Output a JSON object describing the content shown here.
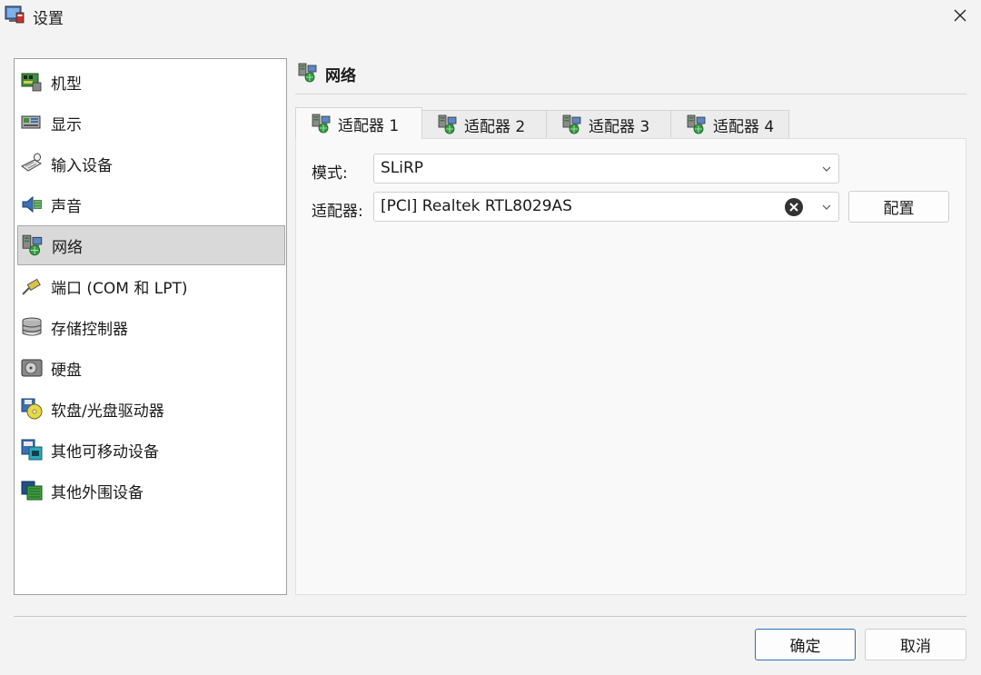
{
  "window": {
    "title": "设置",
    "app_icon": "settings-app-icon",
    "close_icon": "close-icon"
  },
  "sidebar": {
    "items": [
      {
        "label": "机型",
        "icon": "machine-icon",
        "selected": false
      },
      {
        "label": "显示",
        "icon": "display-icon",
        "selected": false
      },
      {
        "label": "输入设备",
        "icon": "input-device-icon",
        "selected": false
      },
      {
        "label": "声音",
        "icon": "sound-icon",
        "selected": false
      },
      {
        "label": "网络",
        "icon": "network-icon",
        "selected": true
      },
      {
        "label": "端口 (COM 和 LPT)",
        "icon": "port-icon",
        "selected": false
      },
      {
        "label": "存储控制器",
        "icon": "storage-controller-icon",
        "selected": false
      },
      {
        "label": "硬盘",
        "icon": "hard-disk-icon",
        "selected": false
      },
      {
        "label": "软盘/光盘驱动器",
        "icon": "floppy-cdrom-icon",
        "selected": false
      },
      {
        "label": "其他可移动设备",
        "icon": "removable-device-icon",
        "selected": false
      },
      {
        "label": "其他外围设备",
        "icon": "peripheral-icon",
        "selected": false
      }
    ]
  },
  "content": {
    "title": "网络",
    "title_icon": "network-icon",
    "tabs": [
      {
        "label": "适配器 1",
        "active": true
      },
      {
        "label": "适配器 2",
        "active": false
      },
      {
        "label": "适配器 3",
        "active": false
      },
      {
        "label": "适配器 4",
        "active": false
      }
    ],
    "mode": {
      "label": "模式:",
      "value": "SLiRP"
    },
    "adapter": {
      "label": "适配器:",
      "value": "[PCI] Realtek RTL8029AS",
      "configure_label": "配置"
    }
  },
  "footer": {
    "ok_label": "确定",
    "cancel_label": "取消"
  },
  "colors": {
    "accent": "#2b6fb8",
    "selected_bg": "#d9d9d9",
    "panel_bg": "#f9f9f9"
  }
}
